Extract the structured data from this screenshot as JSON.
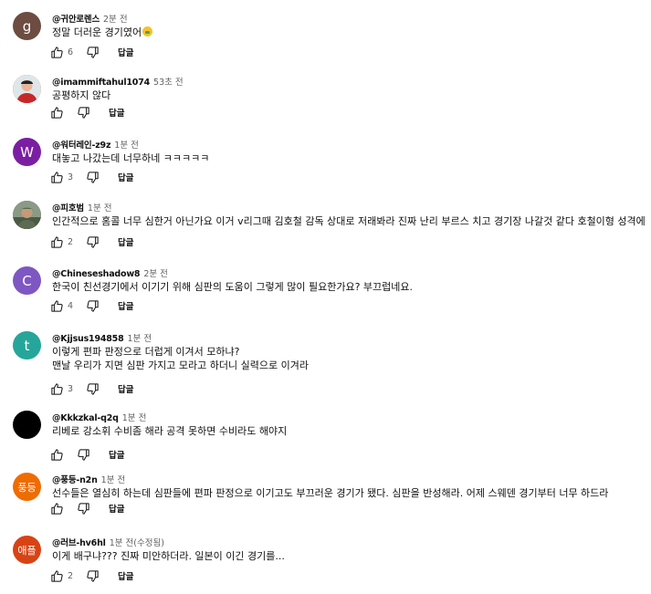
{
  "reply_label": "답글",
  "icons": {
    "like": "thumb-up-icon",
    "dislike": "thumb-down-icon"
  },
  "comments": [
    {
      "author": "@귀안로렌스",
      "time": "2분 전",
      "text": "정말 더러운 경기였어",
      "emoji": "money-mouth-face-emoji",
      "likes": "6",
      "avatar_letter": "g",
      "avatar_color": "#6d4c41"
    },
    {
      "author": "@imammiftahul1074",
      "time": "53초 전",
      "text": "공평하지 않다",
      "likes": "",
      "avatar_letter": "",
      "avatar_color": "#c62828"
    },
    {
      "author": "@워터레인-z9z",
      "time": "1분 전",
      "text": "대놓고 나갔는데 너무하네 ㅋㅋㅋㅋㅋ",
      "likes": "3",
      "avatar_letter": "W",
      "avatar_color": "#7b1fa2"
    },
    {
      "author": "@피호범",
      "time": "1분 전",
      "text": "인간적으로 홈콜 너무 심한거 아닌가요 이거 v리그때 김호철 감독 상대로 저래봐라 진짜 난리 부르스 치고 경기장 나갈것 같다 호철이형 성격에",
      "likes": "2",
      "avatar_letter": "",
      "avatar_color": "#5d6b54"
    },
    {
      "author": "@Chineseshadow8",
      "time": "2분 전",
      "text": "한국이 친선경기에서 이기기 위해 심판의 도움이 그렇게 많이 필요한가요? 부끄럽네요.",
      "likes": "4",
      "avatar_letter": "C",
      "avatar_color": "#7e57c2"
    },
    {
      "author": "@Kjjsus194858",
      "time": "1분 전",
      "text": "이렇게 편파 판정으로 더럽게 이겨서 모하냐?\n맨날 우리가 지면 심판 가지고 모라고 하더니 실력으로 이겨라",
      "likes": "3",
      "avatar_letter": "t",
      "avatar_color": "#26a69a"
    },
    {
      "author": "@Kkkzkal-q2q",
      "time": "1분 전",
      "text": "리베로 강소휘 수비좀 해라 공격 못하면 수비라도 해야지",
      "likes": "",
      "avatar_letter": "",
      "avatar_color": "#000000"
    },
    {
      "author": "@풍등-n2n",
      "time": "1분 전",
      "text": "선수들은 열심히 하는데 심판들에 편파 판정으로 이기고도 부끄러운 경기가 됐다. 심판을 반성해라. 어제 스웨덴 경기부터 너무 하드라",
      "likes": "",
      "avatar_letter": "풍등",
      "avatar_color": "#ef6c00"
    },
    {
      "author": "@러브-hv6hl",
      "time": "1분 전(수정됨)",
      "text": "이게 배구냐??? 진짜 미안하더라. 일본이 이긴 경기를...",
      "likes": "2",
      "avatar_letter": "애플",
      "avatar_color": "#d84315"
    }
  ]
}
